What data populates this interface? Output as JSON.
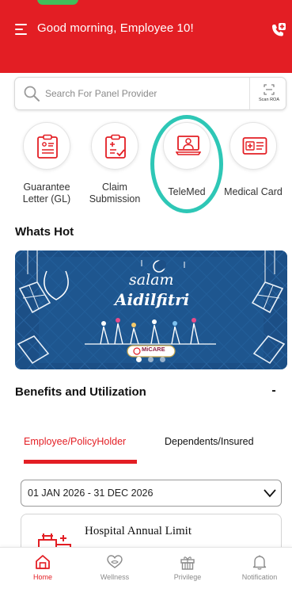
{
  "header": {
    "greeting": "Good morning, Employee 10!",
    "menu_icon": "hamburger-menu-icon",
    "call_icon": "phone-call-icon",
    "brand_color": "#e31e24"
  },
  "search": {
    "placeholder": "Search For Panel Provider",
    "value": "",
    "scan_label": "Scan ROA"
  },
  "quick_actions": [
    {
      "label": "Guarantee Letter (GL)",
      "icon": "guarantee-letter-icon"
    },
    {
      "label": "Claim Submission",
      "icon": "claim-submission-icon"
    },
    {
      "label": "TeleMed",
      "icon": "telemed-doctor-icon"
    },
    {
      "label": "Medical Card",
      "icon": "medical-card-icon"
    }
  ],
  "highlight_color": "#2ec7b6",
  "whats_hot": {
    "title": "Whats Hot",
    "banner_text_line1": "salam",
    "banner_text_line2": "Aidilfitri",
    "banner_logo": "MiCARE",
    "slides": 3,
    "active_slide": 1
  },
  "benefits": {
    "title": "Benefits and Utilization",
    "collapse_label": "-",
    "tabs": [
      {
        "label": "Employee/PolicyHolder",
        "active": true
      },
      {
        "label": "Dependents/Insured",
        "active": false
      }
    ],
    "period": "01 JAN 2026 - 31 DEC 2026",
    "card_title": "Hospital Annual Limit"
  },
  "bottom_nav": [
    {
      "label": "Home",
      "icon": "home-icon",
      "active": true
    },
    {
      "label": "Wellness",
      "icon": "wellness-heart-icon",
      "active": false
    },
    {
      "label": "Privilege",
      "icon": "gift-icon",
      "active": false
    },
    {
      "label": "Notification",
      "icon": "bell-icon",
      "active": false
    }
  ]
}
